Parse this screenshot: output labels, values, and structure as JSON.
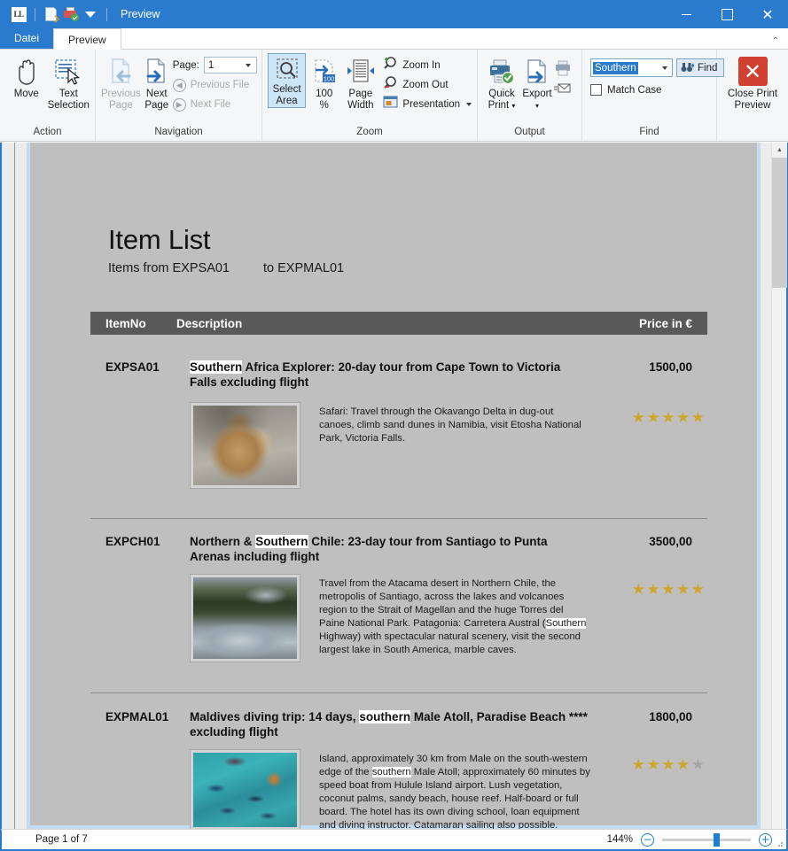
{
  "window": {
    "title": "Preview",
    "app_logo_text": "LL",
    "controls": {
      "minimize": "minimize",
      "maximize": "maximize",
      "close": "close"
    }
  },
  "tabs": [
    {
      "id": "file",
      "label": "Datei",
      "active": false
    },
    {
      "id": "preview",
      "label": "Preview",
      "active": true
    }
  ],
  "ribbon": {
    "groups": [
      {
        "id": "action",
        "label": "Action",
        "buttons": [
          {
            "id": "move",
            "label": "Move",
            "icon": "hand-icon",
            "enabled": true,
            "selected": false
          },
          {
            "id": "text-selection",
            "label": "Text\nSelection",
            "line1": "Text",
            "line2": "Selection",
            "icon": "text-selection-icon",
            "enabled": true,
            "selected": false
          }
        ]
      },
      {
        "id": "navigation",
        "label": "Navigation",
        "buttons": [
          {
            "id": "previous-page",
            "line1": "Previous",
            "line2": "Page",
            "icon": "page-back-icon",
            "enabled": false
          },
          {
            "id": "next-page",
            "line1": "Next",
            "line2": "Page",
            "icon": "page-forward-icon",
            "enabled": true
          }
        ],
        "page_label": "Page:",
        "page_value": "1",
        "small_buttons": [
          {
            "id": "previous-file",
            "label": "Previous File",
            "enabled": false
          },
          {
            "id": "next-file",
            "label": "Next File",
            "enabled": false
          }
        ]
      },
      {
        "id": "zoom",
        "label": "Zoom",
        "buttons": [
          {
            "id": "select-area",
            "line1": "Select",
            "line2": "Area",
            "icon": "select-area-icon",
            "selected": true
          },
          {
            "id": "zoom-100",
            "line1": "100",
            "line2": "%",
            "icon": "zoom-100-icon",
            "selected": false
          },
          {
            "id": "page-width",
            "line1": "Page",
            "line2": "Width",
            "icon": "page-width-icon",
            "selected": false
          }
        ],
        "small_buttons": [
          {
            "id": "zoom-in",
            "label": "Zoom In",
            "icon": "zoom-in-icon"
          },
          {
            "id": "zoom-out",
            "label": "Zoom Out",
            "icon": "zoom-out-icon"
          },
          {
            "id": "presentation",
            "label": "Presentation",
            "icon": "presentation-icon",
            "has_dropdown": true
          }
        ]
      },
      {
        "id": "output",
        "label": "Output",
        "buttons": [
          {
            "id": "quick-print",
            "line1": "Quick",
            "line2": "Print",
            "icon": "printer-check-icon",
            "has_dropdown": true
          },
          {
            "id": "export",
            "line1": "Export",
            "line2": "",
            "icon": "export-icon",
            "has_dropdown": true
          }
        ],
        "small_icons": [
          {
            "id": "print",
            "icon": "printer-icon"
          },
          {
            "id": "send-mail",
            "icon": "send-mail-icon"
          }
        ]
      },
      {
        "id": "find",
        "label": "Find",
        "search_value": "Southern",
        "find_label": "Find",
        "find_icon": "binoculars-icon",
        "match_case_label": "Match Case",
        "match_case_checked": false
      },
      {
        "id": "close",
        "label": "",
        "close_button": {
          "id": "close-print-preview",
          "line1": "Close Print",
          "line2": "Preview",
          "icon": "red-x-icon"
        }
      }
    ]
  },
  "document": {
    "title": "Item List",
    "subtitle_from": "Items from EXPSA01",
    "subtitle_to": "to EXPMAL01",
    "columns": {
      "itemno": "ItemNo",
      "description": "Description",
      "price": "Price in €"
    },
    "items": [
      {
        "code": "EXPSA01",
        "title_pre": "",
        "title_hl": "Southern",
        "title_post": " Africa Explorer: 20-day tour from Cape Town to Victoria Falls excluding flight",
        "price": "1500,00",
        "image": "lion-photo",
        "description_pre": "Safari: Travel through the Okavango Delta in dug-out canoes, climb sand dunes in Namibia, visit Etosha National Park, Victoria Falls.",
        "description_hl": "",
        "description_post": "",
        "stars_filled": 5,
        "stars_total": 5
      },
      {
        "code": "EXPCH01",
        "title_pre": "Northern & ",
        "title_hl": "Southern",
        "title_post": " Chile: 23-day tour from Santiago to Punta Arenas including flight",
        "price": "3500,00",
        "image": "river-photo",
        "description_pre": "Travel from the Atacama desert in Northern Chile, the metropolis of Santiago, across the lakes and volcanoes region to the Strait of Magellan and the huge Torres del Paine National Park. Patagonia: Carretera Austral (",
        "description_hl": "Southern",
        "description_post": " Highway) with spectacular natural scenery, visit the second largest lake in South America, marble caves.",
        "stars_filled": 5,
        "stars_total": 5
      },
      {
        "code": "EXPMAL01",
        "title_pre": "Maldives diving trip: 14 days, ",
        "title_hl": "southern",
        "title_post": " Male Atoll, Paradise Beach **** excluding flight",
        "price": "1800,00",
        "image": "fish-photo",
        "description_pre": "Island, approximately 30 km from Male on the south-western edge of the ",
        "description_hl": "southern",
        "description_post": " Male Atoll; approximately 60 minutes by speed boat from Hulule Island airport. Lush vegetation, coconut palms, sandy beach, house reef. Half-board or full board. The hotel has its own diving school, loan equipment and diving instructor. Catamaran sailing also possible.",
        "stars_filled": 4,
        "stars_total": 5
      }
    ]
  },
  "statusbar": {
    "page_text": "Page 1 of 7",
    "zoom_text": "144%",
    "zoom_out_label": "−",
    "zoom_in_label": "+"
  },
  "colors": {
    "accent": "#2a7bce",
    "header_band": "#595959",
    "page_bg": "#bfbfbf",
    "star_on": "#cfa52b",
    "star_off": "#a6a6a6",
    "close_red": "#d0412f"
  }
}
